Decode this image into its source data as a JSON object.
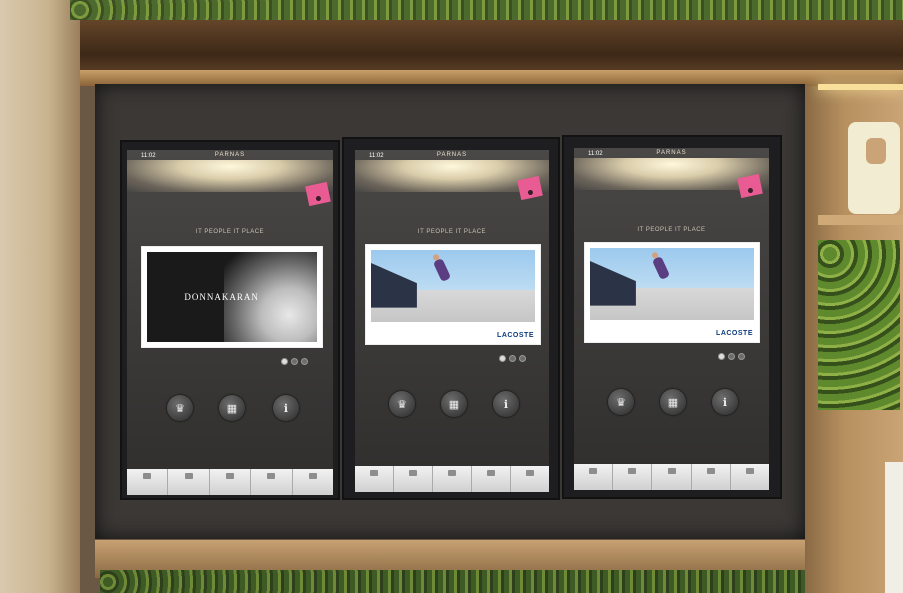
{
  "screens": [
    {
      "status": {
        "time": "11:02",
        "logo": "PARNAS",
        "right": ""
      },
      "tag": {
        "text": ""
      },
      "intro": "",
      "tagline": "IT PEOPLE IT PLACE",
      "ad": {
        "brand": "DONNAKARAN",
        "footer_left": "",
        "footer_right": ""
      },
      "dots": [
        true,
        false,
        false
      ],
      "buttons": [
        {
          "icon": "crown-icon",
          "label": ""
        },
        {
          "icon": "map-icon",
          "label": ""
        },
        {
          "icon": "info-icon",
          "label": ""
        }
      ],
      "menu": [
        "",
        "",
        "",
        "",
        ""
      ]
    },
    {
      "status": {
        "time": "11:02",
        "logo": "PARNAS",
        "right": ""
      },
      "tag": {
        "text": ""
      },
      "intro": "",
      "tagline": "IT PEOPLE IT PLACE",
      "ad": {
        "brand": "",
        "footer_left": "",
        "footer_right": "LACOSTE"
      },
      "dots": [
        true,
        false,
        false
      ],
      "buttons": [
        {
          "icon": "crown-icon",
          "label": ""
        },
        {
          "icon": "map-icon",
          "label": ""
        },
        {
          "icon": "info-icon",
          "label": ""
        }
      ],
      "menu": [
        "",
        "",
        "",
        "",
        ""
      ]
    },
    {
      "status": {
        "time": "11:02",
        "logo": "PARNAS",
        "right": ""
      },
      "tag": {
        "text": ""
      },
      "intro": "",
      "tagline": "IT PEOPLE IT PLACE",
      "ad": {
        "brand": "",
        "footer_left": "",
        "footer_right": "LACOSTE"
      },
      "dots": [
        true,
        false,
        false
      ],
      "buttons": [
        {
          "icon": "crown-icon",
          "label": ""
        },
        {
          "icon": "map-icon",
          "label": ""
        },
        {
          "icon": "info-icon",
          "label": ""
        }
      ],
      "menu": [
        "",
        "",
        "",
        "",
        ""
      ]
    }
  ]
}
